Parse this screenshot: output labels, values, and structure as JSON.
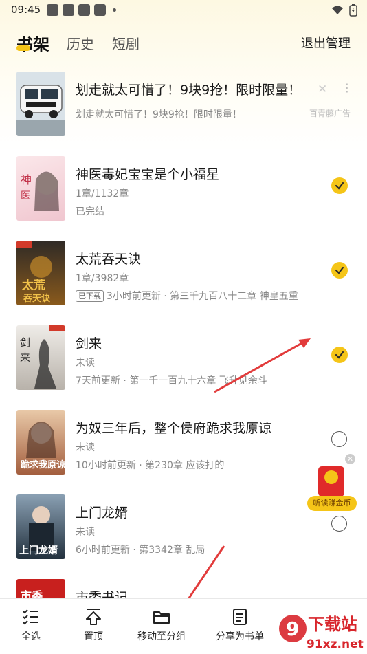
{
  "status_bar": {
    "time": "09:45"
  },
  "tabs": {
    "bookshelf": "书架",
    "history": "历史",
    "short_drama": "短剧"
  },
  "header": {
    "exit_manage": "退出管理"
  },
  "ad": {
    "title": "划走就太可惜了！9块9抢！限时限量！",
    "subtitle": "划走就太可惜了！9块9抢！限时限量！",
    "tag": "百青藤广告",
    "close": "✕",
    "more": "⋮"
  },
  "books": [
    {
      "title": "神医毒妃宝宝是个小福星",
      "progress": "1章/1132章",
      "status": "已完结",
      "update": "",
      "downloaded": false,
      "checked": true,
      "cover_color": "#f4d9dd"
    },
    {
      "title": "太荒吞天诀",
      "progress": "1章/3982章",
      "status": "",
      "update": "3小时前更新 · 第三千九百八十二章 神皇五重",
      "downloaded": true,
      "download_tag": "已下载",
      "checked": true,
      "cover_color": "#5a3a1a"
    },
    {
      "title": "剑来",
      "progress": "未读",
      "status": "",
      "update": "7天前更新 · 第一千一百九十六章 飞升见余斗",
      "downloaded": false,
      "checked": true,
      "cover_color": "#d8d4cf"
    },
    {
      "title": "为奴三年后，整个侯府跪求我原谅",
      "progress": "未读",
      "status": "",
      "update": "10小时前更新 · 第230章 应该打的",
      "downloaded": false,
      "checked": false,
      "cover_color": "#c99b7a"
    },
    {
      "title": "上门龙婿",
      "progress": "未读",
      "status": "",
      "update": "6小时前更新 · 第3342章 乱局",
      "downloaded": false,
      "checked": false,
      "cover_color": "#3b4f63"
    },
    {
      "title": "市委书记",
      "progress": "",
      "status": "",
      "update": "",
      "downloaded": false,
      "checked": false,
      "cover_color": "#c8201e"
    }
  ],
  "float_widget": {
    "label": "听读赚金币",
    "close": "✕"
  },
  "bottom_bar": {
    "select_all": "全选",
    "pin_top": "置顶",
    "move_to_group": "移动至分组",
    "share_booklist": "分享为书单"
  },
  "watermark": {
    "brand": "下载站",
    "url": "91xz.net"
  },
  "colors": {
    "accent": "#f5c518",
    "arrow": "#e23b3b"
  }
}
